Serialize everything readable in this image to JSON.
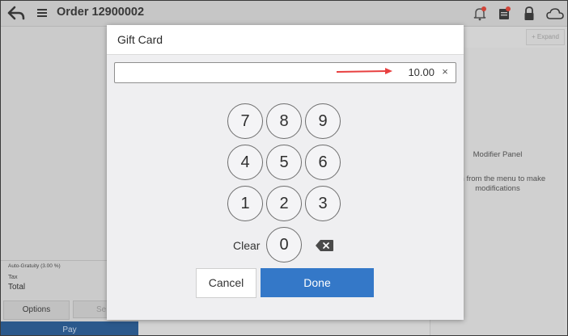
{
  "header": {
    "title": "Order 12900002"
  },
  "order_panel": {
    "auto_gratuity": "Auto-Gratuity (3.00 %)",
    "tax": "Tax",
    "total": "Total",
    "options_label": "Options",
    "second_button_partial": "Se",
    "pay_label": "Pay"
  },
  "modifier_panel": {
    "expand_label": "Expand",
    "title": "Modifier Panel",
    "hint_line1": "item from the menu to make",
    "hint_line2": "modifications"
  },
  "dialog": {
    "title": "Gift Card",
    "amount": "10.00",
    "clear_x": "×",
    "keys": [
      "7",
      "8",
      "9",
      "4",
      "5",
      "6",
      "1",
      "2",
      "3",
      "0"
    ],
    "clear_label": "Clear",
    "cancel_label": "Cancel",
    "done_label": "Done"
  },
  "colors": {
    "accent": "#3478c8",
    "pay_bar": "#2d5d92",
    "annotation_arrow": "#e84040",
    "badge": "#d9463a"
  }
}
